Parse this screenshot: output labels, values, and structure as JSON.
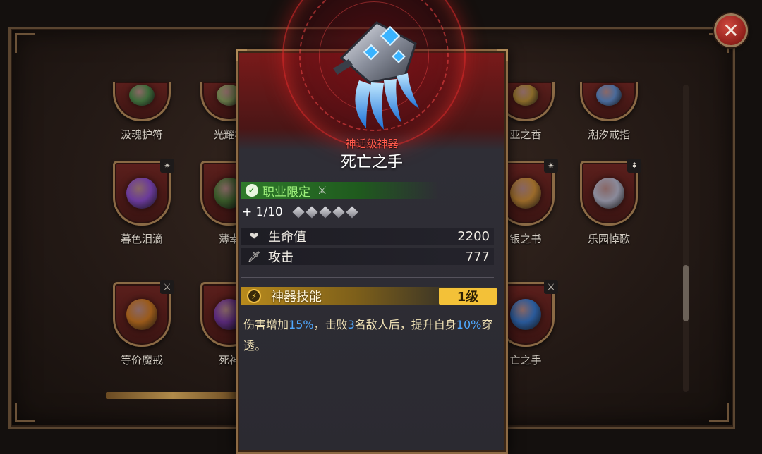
{
  "background": {
    "cards": [
      {
        "label": "汲魂护符",
        "color": "#3e6a3a",
        "badge": ""
      },
      {
        "label": "光耀根",
        "color": "#6a7a4a",
        "badge": ""
      },
      {
        "label": "亚之香",
        "color": "#8a6a2a",
        "badge": ""
      },
      {
        "label": "潮汐戒指",
        "color": "#4a6a9a",
        "badge": ""
      },
      {
        "label": "暮色泪滴",
        "color": "#6a3a9a",
        "badge": "✴"
      },
      {
        "label": "薄幸",
        "color": "#3a5a2a",
        "badge": ""
      },
      {
        "label": "银之书",
        "color": "#9a6a2a",
        "badge": "✴"
      },
      {
        "label": "乐园悼歌",
        "color": "#8a8a9a",
        "badge": "⇞"
      },
      {
        "label": "等价魔戒",
        "color": "#9a5a1a",
        "badge": "⚔"
      },
      {
        "label": "死神",
        "color": "#5a2a7a",
        "badge": ""
      },
      {
        "label": "亡之手",
        "color": "#2a5a9a",
        "badge": "⚔"
      }
    ]
  },
  "close": {
    "icon": "close-icon",
    "glyph": "✕"
  },
  "tooltip": {
    "rarity": "神话级神器",
    "name": "死亡之手",
    "class_restriction": {
      "label": "职业限定",
      "check_glyph": "✓",
      "class_icon": "⚔"
    },
    "level": {
      "text": "+ 1/10",
      "stars_total": 5,
      "stars_filled": 0
    },
    "stats": [
      {
        "icon": "heart-icon",
        "glyph": "❤",
        "label": "生命值",
        "value": "2200"
      },
      {
        "icon": "sword-icon",
        "glyph": "🗡",
        "label": "攻击",
        "value": "777"
      }
    ],
    "skill": {
      "icon": "lightning-icon",
      "glyph": "⚡",
      "label": "神器技能",
      "level": "1级",
      "desc_parts": [
        {
          "text": "伤害增加",
          "hl": false
        },
        {
          "text": "15%",
          "hl": true
        },
        {
          "text": "，击败",
          "hl": false
        },
        {
          "text": "3",
          "hl": true
        },
        {
          "text": "名敌人后，提升自身",
          "hl": false
        },
        {
          "text": "10%",
          "hl": true
        },
        {
          "text": "穿透。",
          "hl": false
        }
      ]
    }
  },
  "colors": {
    "rarity": "#ff5a4c",
    "class_bar": "#2e7a2a",
    "skill_level": "#f3c138",
    "highlight": "#4fa8ff"
  }
}
